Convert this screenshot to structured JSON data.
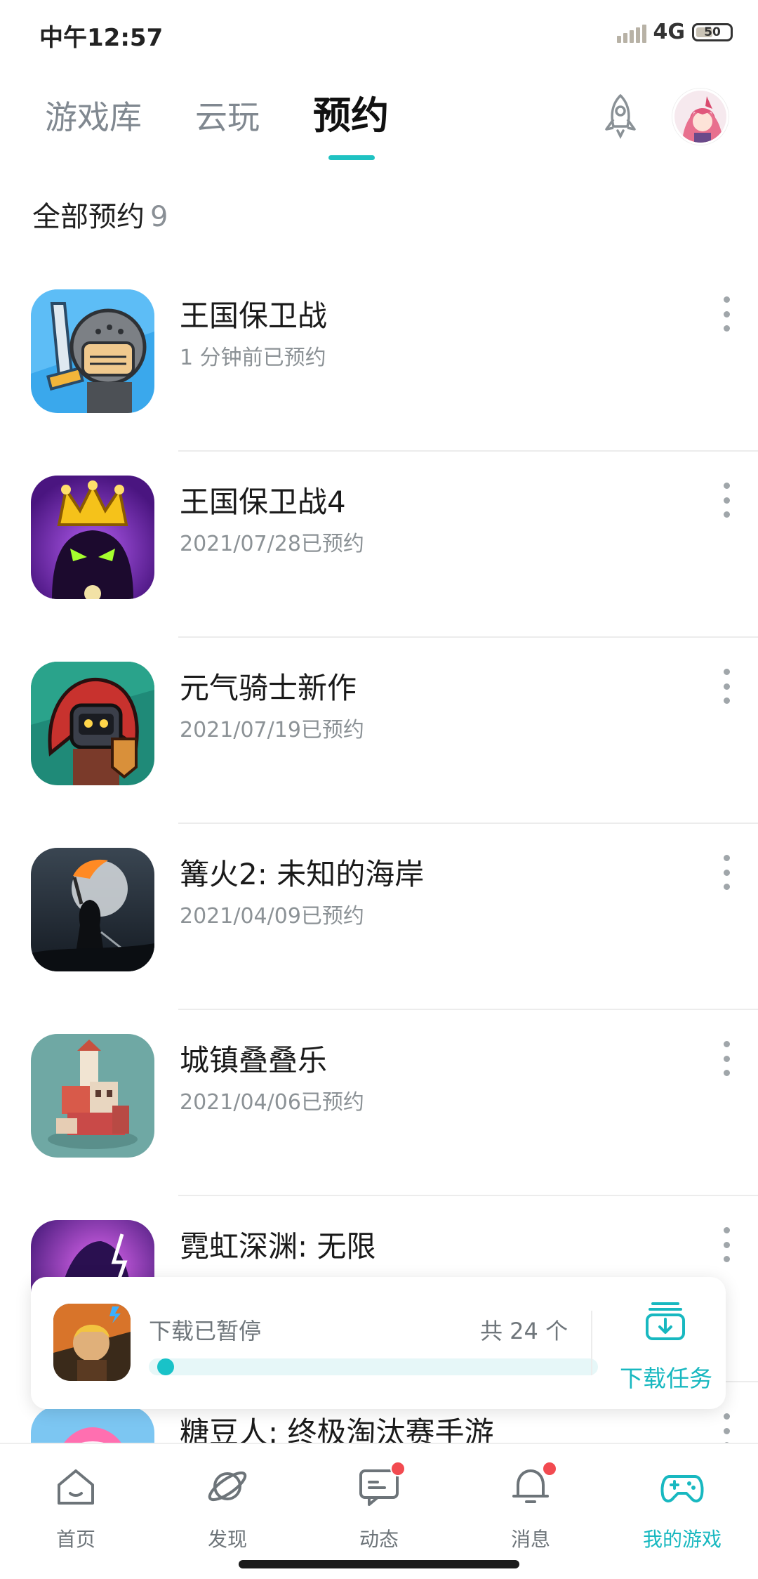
{
  "status_bar": {
    "time": "中午12:57",
    "network": "4G",
    "battery": "50",
    "battery_level": 0.5
  },
  "top_tabs": [
    {
      "label": "游戏库",
      "active": false
    },
    {
      "label": "云玩",
      "active": false
    },
    {
      "label": "预约",
      "active": true
    }
  ],
  "icons": {
    "rocket": "rocket-icon",
    "avatar": "user-avatar",
    "more": "more-vertical-icon"
  },
  "section": {
    "title": "全部预约",
    "count": "9"
  },
  "reservations": [
    {
      "name": "王国保卫战",
      "date": "1 分钟前已预约",
      "icon": "kingdom-rush-icon"
    },
    {
      "name": "王国保卫战4",
      "date": "2021/07/28已预约",
      "icon": "kingdom-rush-4-icon"
    },
    {
      "name": "元气骑士新作",
      "date": "2021/07/19已预约",
      "icon": "soul-knight-new-icon"
    },
    {
      "name": "篝火2: 未知的海岸",
      "date": "2021/04/09已预约",
      "icon": "bonfire-2-icon"
    },
    {
      "name": "城镇叠叠乐",
      "date": "2021/04/06已预约",
      "icon": "townscaper-icon"
    },
    {
      "name": "霓虹深渊: 无限",
      "date": "",
      "icon": "neon-abyss-icon"
    },
    {
      "name": "糖豆人: 终极淘汰赛手游",
      "date": "",
      "icon": "fall-guys-icon"
    }
  ],
  "download": {
    "status": "下载已暂停",
    "total": "共 24 个",
    "progress": 0.02,
    "task_label": "下载任务",
    "thumb_icon": "game-thumb-icon",
    "accent": "#19c2c8"
  },
  "bottom_nav": [
    {
      "label": "首页",
      "icon": "home-icon",
      "active": false,
      "badge": false
    },
    {
      "label": "发现",
      "icon": "planet-icon",
      "active": false,
      "badge": false
    },
    {
      "label": "动态",
      "icon": "chat-icon",
      "active": false,
      "badge": true
    },
    {
      "label": "消息",
      "icon": "bell-icon",
      "active": false,
      "badge": true
    },
    {
      "label": "我的游戏",
      "icon": "gamepad-icon",
      "active": true,
      "badge": false
    }
  ],
  "colors": {
    "accent": "#1fc2c2",
    "badge": "#f24a50",
    "muted": "#8c9296"
  }
}
